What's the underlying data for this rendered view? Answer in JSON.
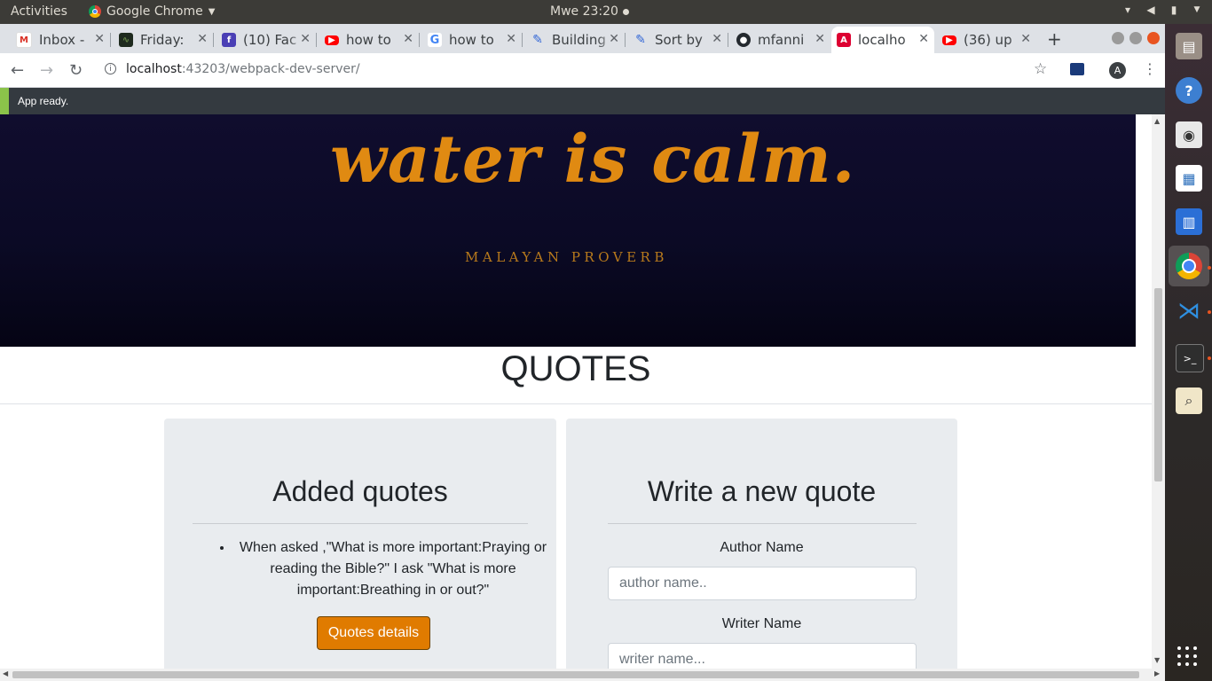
{
  "system": {
    "activities": "Activities",
    "app_name": "Google Chrome",
    "clock": "Mwe 23:20"
  },
  "browser": {
    "tabs": [
      {
        "title": "Inbox - ",
        "icon": "gmail-icon"
      },
      {
        "title": "Friday: ",
        "icon": "page-icon"
      },
      {
        "title": "(10) Fac",
        "icon": "facebook-icon"
      },
      {
        "title": "how to ",
        "icon": "youtube-icon"
      },
      {
        "title": "how to ",
        "icon": "google-icon"
      },
      {
        "title": "Building",
        "icon": "pen-icon"
      },
      {
        "title": "Sort by ",
        "icon": "pen-icon"
      },
      {
        "title": "mfanni",
        "icon": "github-icon"
      },
      {
        "title": "localho",
        "icon": "angular-icon",
        "active": true
      },
      {
        "title": "(36) up",
        "icon": "youtube-icon"
      }
    ],
    "url_host": "localhost",
    "url_rest": ":43203/webpack-dev-server/",
    "profile_initial": "A"
  },
  "status_bar": {
    "text": "App ready."
  },
  "hero": {
    "quote_line": "water is calm.",
    "attribution": "MALAYAN PROVERB"
  },
  "page": {
    "title": "QUOTES"
  },
  "added_quotes": {
    "heading": "Added quotes",
    "items": [
      "When asked ,\"What is more important:Praying or reading the Bible?\" I ask \"What is more important:Breathing in or out?\""
    ],
    "details_button": "Quotes details"
  },
  "new_quote": {
    "heading": "Write a new quote",
    "author_label": "Author Name",
    "author_placeholder": "author name..",
    "writer_label": "Writer Name",
    "writer_placeholder": "writer name..."
  },
  "colors": {
    "accent_orange": "#e07b00",
    "hero_text": "#e08a12",
    "card_bg": "#e9ecef",
    "ready_bar": "#343a40"
  }
}
